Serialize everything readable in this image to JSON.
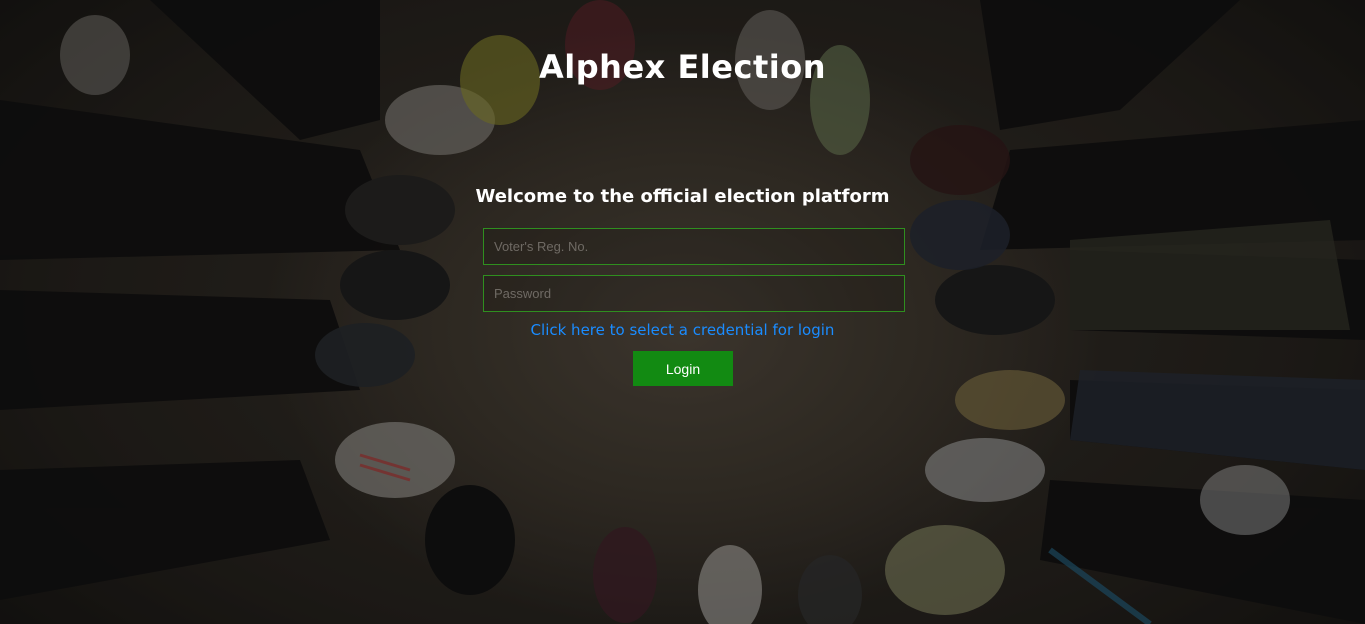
{
  "page": {
    "title": "Alphex Election",
    "welcome": "Welcome to the official election platform"
  },
  "form": {
    "reg_no": {
      "placeholder": "Voter's Reg. No.",
      "value": ""
    },
    "password": {
      "placeholder": "Password",
      "value": ""
    },
    "credential_link": "Click here to select a credential for login",
    "login_label": "Login"
  },
  "colors": {
    "accent_border": "#2f8f1f",
    "link": "#1a8cff",
    "button": "#128a12"
  }
}
